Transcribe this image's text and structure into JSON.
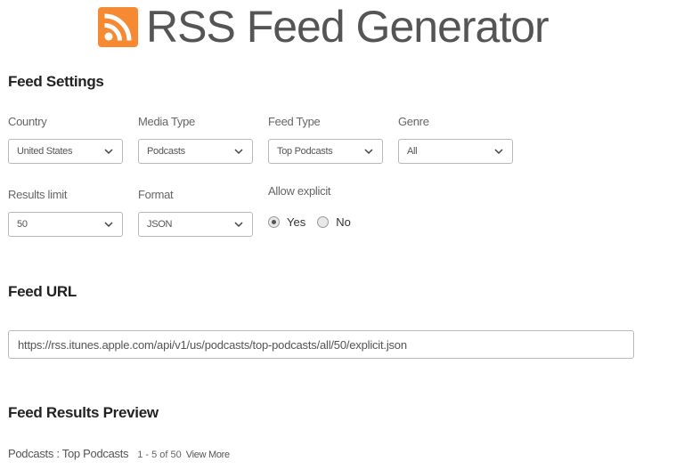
{
  "header": {
    "title": "RSS Feed Generator",
    "logo_icon": "rss-icon",
    "logo_color": "#f58a33"
  },
  "feed_settings": {
    "title": "Feed Settings",
    "country": {
      "label": "Country",
      "value": "United States"
    },
    "media_type": {
      "label": "Media Type",
      "value": "Podcasts"
    },
    "feed_type": {
      "label": "Feed Type",
      "value": "Top Podcasts"
    },
    "genre": {
      "label": "Genre",
      "value": "All"
    },
    "results_limit": {
      "label": "Results limit",
      "value": "50"
    },
    "format": {
      "label": "Format",
      "value": "JSON"
    },
    "allow_explicit": {
      "label": "Allow explicit",
      "options": [
        {
          "label": "Yes",
          "checked": true
        },
        {
          "label": "No",
          "checked": false
        }
      ]
    }
  },
  "feed_url": {
    "title": "Feed URL",
    "value": "https://rss.itunes.apple.com/api/v1/us/podcasts/top-podcasts/all/50/explicit.json"
  },
  "preview": {
    "title": "Feed Results Preview",
    "heading": "Podcasts : Top Podcasts",
    "count": "1 - 5 of 50",
    "view_more": "View More"
  }
}
